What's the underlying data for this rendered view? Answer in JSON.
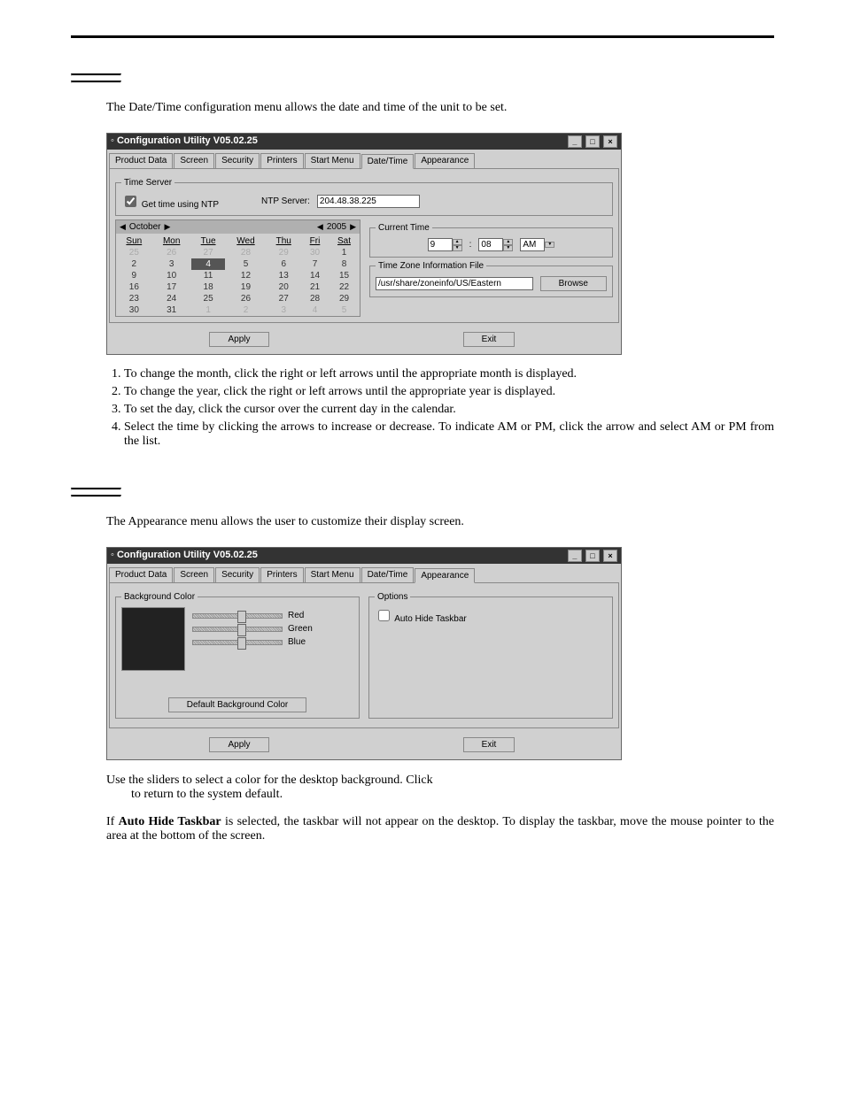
{
  "page": {
    "intro_datetime": "The Date/Time configuration menu allows the date and time of the unit to be set.",
    "steps": [
      "To change the month, click the right or left arrows until the appropriate month is displayed.",
      "To change the year, click the right or left arrows until the appropriate year is displayed.",
      "To set the day, click the cursor over the current day in the calendar.",
      "Select the time by clicking the arrows to increase or decrease. To indicate AM or PM, click the arrow and select AM or PM from the list."
    ],
    "intro_appearance": "The Appearance menu allows the user to customize their display screen.",
    "appearance_note_1": "Use the sliders to select a color for the desktop background. Click",
    "appearance_note_2": "to return to the system default.",
    "autohide_note_a": "If ",
    "autohide_bold": "Auto Hide Taskbar",
    "autohide_note_b": " is selected, the taskbar will not appear on the desktop. To display the taskbar, move the mouse pointer to the area at the bottom of the screen."
  },
  "shot1": {
    "title": "Configuration Utility V05.02.25",
    "tabs": [
      "Product Data",
      "Screen",
      "Security",
      "Printers",
      "Start Menu",
      "Date/Time",
      "Appearance"
    ],
    "active_tab": "Date/Time",
    "time_server_legend": "Time Server",
    "ntp_check_label": "Get time using NTP",
    "ntp_server_label": "NTP Server:",
    "ntp_server_value": "204.48.38.225",
    "month": "October",
    "year": "2005",
    "dow": [
      "Sun",
      "Mon",
      "Tue",
      "Wed",
      "Thu",
      "Fri",
      "Sat"
    ],
    "cal": [
      [
        {
          "v": "25",
          "d": true
        },
        {
          "v": "26",
          "d": true
        },
        {
          "v": "27",
          "d": true
        },
        {
          "v": "28",
          "d": true
        },
        {
          "v": "29",
          "d": true
        },
        {
          "v": "30",
          "d": true
        },
        {
          "v": "1"
        }
      ],
      [
        {
          "v": "2"
        },
        {
          "v": "3"
        },
        {
          "v": "4",
          "sel": true
        },
        {
          "v": "5"
        },
        {
          "v": "6"
        },
        {
          "v": "7"
        },
        {
          "v": "8"
        }
      ],
      [
        {
          "v": "9"
        },
        {
          "v": "10"
        },
        {
          "v": "11"
        },
        {
          "v": "12"
        },
        {
          "v": "13"
        },
        {
          "v": "14"
        },
        {
          "v": "15"
        }
      ],
      [
        {
          "v": "16"
        },
        {
          "v": "17"
        },
        {
          "v": "18"
        },
        {
          "v": "19"
        },
        {
          "v": "20"
        },
        {
          "v": "21"
        },
        {
          "v": "22"
        }
      ],
      [
        {
          "v": "23"
        },
        {
          "v": "24"
        },
        {
          "v": "25"
        },
        {
          "v": "26"
        },
        {
          "v": "27"
        },
        {
          "v": "28"
        },
        {
          "v": "29"
        }
      ],
      [
        {
          "v": "30"
        },
        {
          "v": "31"
        },
        {
          "v": "1",
          "d": true
        },
        {
          "v": "2",
          "d": true
        },
        {
          "v": "3",
          "d": true
        },
        {
          "v": "4",
          "d": true
        },
        {
          "v": "5",
          "d": true
        }
      ]
    ],
    "current_time_legend": "Current Time",
    "hour": "9",
    "minute": "08",
    "ampm": "AM",
    "tz_legend": "Time Zone Information File",
    "tz_value": "/usr/share/zoneinfo/US/Eastern",
    "browse": "Browse",
    "apply": "Apply",
    "exit": "Exit"
  },
  "shot2": {
    "title": "Configuration Utility V05.02.25",
    "tabs": [
      "Product Data",
      "Screen",
      "Security",
      "Printers",
      "Start Menu",
      "Date/Time",
      "Appearance"
    ],
    "active_tab": "Appearance",
    "bg_legend": "Background Color",
    "red": "Red",
    "green": "Green",
    "blue": "Blue",
    "default_btn": "Default Background Color",
    "options_legend": "Options",
    "autohide_label": "Auto Hide Taskbar",
    "apply": "Apply",
    "exit": "Exit"
  }
}
